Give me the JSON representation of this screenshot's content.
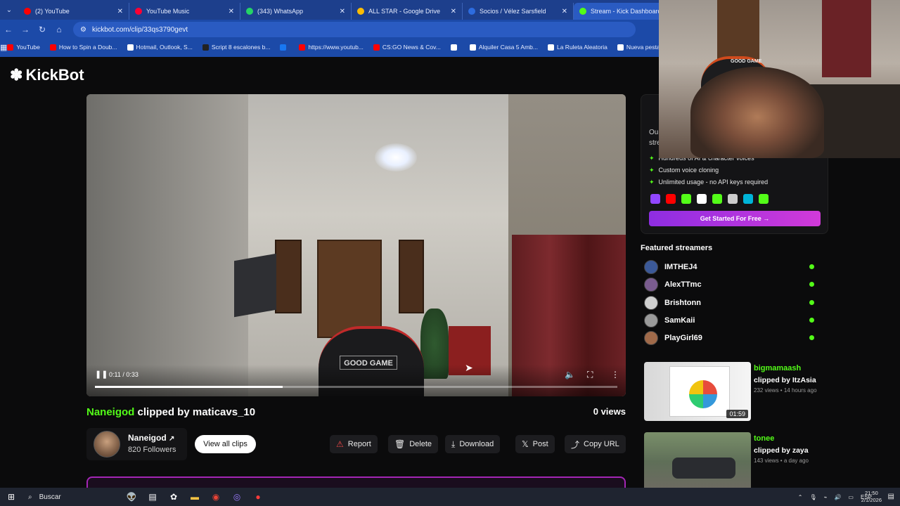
{
  "browser": {
    "tabs": [
      {
        "label": "(2) YouTube",
        "color": "#ff0000",
        "active": false
      },
      {
        "label": "YouTube Music",
        "color": "#ff0033",
        "active": false
      },
      {
        "label": "(343) WhatsApp",
        "color": "#25d366",
        "active": false
      },
      {
        "label": "ALL STAR - Google Drive",
        "color": "#fbbc04",
        "active": false
      },
      {
        "label": "Socios / Vélez Sarsfield",
        "color": "#2d6cdf",
        "active": false
      },
      {
        "label": "Stream - Kick Dashboard",
        "color": "#53fc18",
        "active": true
      }
    ],
    "url": "kickbot.com/clip/33qs3790gevt",
    "bookmarks": [
      {
        "label": "YouTube",
        "color": "#ff0000"
      },
      {
        "label": "How to Spin a Doub...",
        "color": "#ff0000"
      },
      {
        "label": "Hotmail, Outlook, S...",
        "color": "#ffffff"
      },
      {
        "label": "Script 8 escalones b...",
        "color": "#222222"
      },
      {
        "label": "",
        "color": "#1877f2"
      },
      {
        "label": "https://www.youtub...",
        "color": "#ff0000"
      },
      {
        "label": "CS:GO News & Cov...",
        "color": "#ff0000"
      },
      {
        "label": "",
        "color": "#ffffff"
      },
      {
        "label": "Alquiler Casa 5 Amb...",
        "color": "#ffffff"
      },
      {
        "label": "La Ruleta Aleatoria",
        "color": "#ffffff"
      },
      {
        "label": "Nueva pestaña",
        "color": "#ffffff"
      }
    ]
  },
  "site": {
    "logo": "KickBot"
  },
  "player": {
    "time": "0:11 / 0:33",
    "progress": 0.36,
    "chair_text": "GOOD GAME"
  },
  "clip": {
    "channel": "Naneigod",
    "clipped_by_text": " clipped by maticavs_10",
    "views": "0 views"
  },
  "streamer": {
    "name": "Naneigod",
    "followers": "820 Followers",
    "view_all": "View all clips"
  },
  "actions": [
    {
      "label": "Report",
      "icon": "⚠"
    },
    {
      "label": "Delete",
      "icon": "🗑"
    },
    {
      "label": "Download",
      "icon": "⤓"
    },
    {
      "label": "Post",
      "icon": "𝕏"
    },
    {
      "label": "Copy URL",
      "icon": "⤴"
    }
  ],
  "promo": {
    "partial_1": "Ou",
    "partial_2": "stre",
    "features": [
      "Hundreds of AI & character voices",
      "Custom voice cloning",
      "Unlimited usage - no API keys required"
    ],
    "platform_colors": [
      "#9146ff",
      "#ff0000",
      "#53fc18",
      "#ffffff",
      "#53fc18",
      "#cccccc",
      "#00b4d8",
      "#53fc18"
    ],
    "cta": "Get Started For Free →"
  },
  "webcam": {
    "chair_text": "GOOD GAME"
  },
  "featured": {
    "title": "Featured streamers",
    "streamers": [
      {
        "name": "IMTHEJ4",
        "color": "#3b5998"
      },
      {
        "name": "AlexTTmc",
        "color": "#7a5c8f"
      },
      {
        "name": "Brishtonn",
        "color": "#cfcfcf"
      },
      {
        "name": "SamKaii",
        "color": "#9a9a9a"
      },
      {
        "name": "PlayGirl69",
        "color": "#a06a4a"
      }
    ]
  },
  "side_clips": [
    {
      "channel": "bigmamaash",
      "by": "clipped by ItzAsia",
      "meta": "232 views • 14 hours ago",
      "duration": "01:59"
    },
    {
      "channel": "tonee",
      "by": "clipped by zaya",
      "meta": "143 views • a day ago",
      "duration": ""
    }
  ],
  "taskbar": {
    "search": "Buscar",
    "lang": "ESP",
    "time": "21:50",
    "date": "2/1/2026"
  }
}
